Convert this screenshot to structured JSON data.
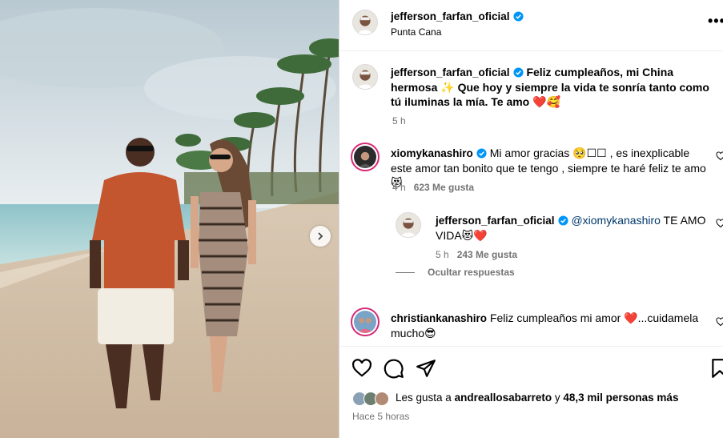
{
  "post": {
    "author": "jefferson_farfan_oficial",
    "location": "Punta Cana",
    "more_label": "•••",
    "caption": "Feliz cumpleaños, mi China hermosa ✨ Que hoy y siempre la vida te sonría tanto como tú iluminas la mía. Te amo ❤️🥰",
    "caption_time": "5 h"
  },
  "comments": [
    {
      "user": "xiomykanashiro",
      "text": "Mi amor gracias 🥺☐☐ , es inexplicable este amor tan bonito que te tengo , siempre te haré feliz te amo 😻",
      "time": "4 h",
      "likes": "623 Me gusta"
    },
    {
      "user": "jefferson_farfan_oficial",
      "mention": "@xiomykanashiro",
      "text": " TE AMO VIDA😻❤️",
      "time": "5 h",
      "likes": "243 Me gusta"
    },
    {
      "user": "christiankanashiro",
      "text": "Feliz cumpleaños mi amor ❤️...cuidamela mucho😎"
    }
  ],
  "replies_toggle": "Ocultar respuestas",
  "footer": {
    "likes_prefix": "Les gusta a ",
    "likes_user": "andreallosabarreto",
    "likes_mid": " y ",
    "likes_count": "48,3 mil personas más",
    "time_ago": "Hace 5 horas"
  },
  "colors": {
    "verified": "#0095f6",
    "muted": "#737373",
    "heart": "#ed4956"
  }
}
